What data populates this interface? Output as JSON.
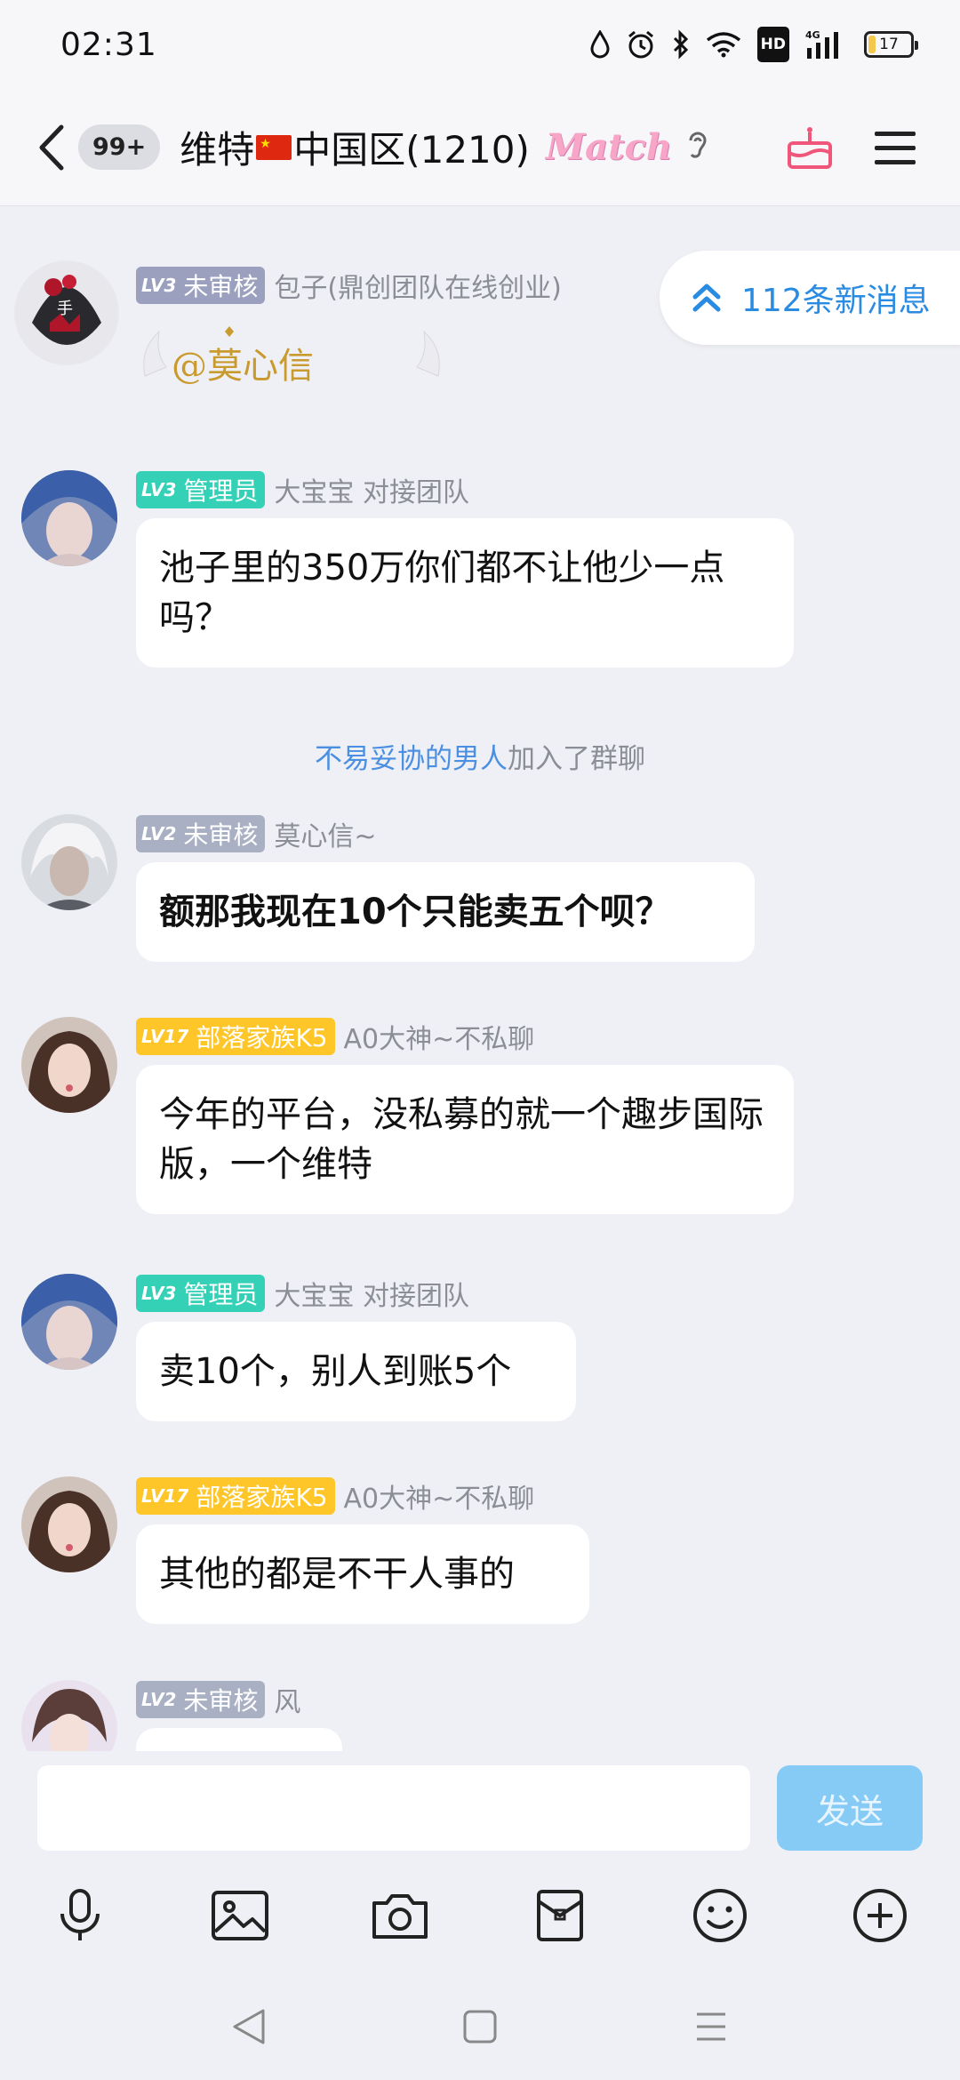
{
  "status_bar": {
    "time": "02:31",
    "network": "4G",
    "hd": "HD",
    "battery": "17",
    "battery_level": 0.17
  },
  "header": {
    "unread_count": "99+",
    "title_prefix": "维特",
    "title_suffix": "中国区(1210)",
    "logo_text": "Match"
  },
  "new_messages": {
    "label": "112条新消息"
  },
  "messages": [
    {
      "level": "LV3",
      "role": "未审核",
      "nick": "包子(鼎创团队在线创业)",
      "sticker_text": "@莫心信"
    },
    {
      "level": "LV3",
      "role": "管理员",
      "nick": "大宝宝 对接团队",
      "text": "池子里的350万你们都不让他少一点吗？"
    },
    {
      "level": "LV2",
      "role": "未审核",
      "nick": "莫心信~",
      "text": "额那我现在10个只能卖五个呗？"
    },
    {
      "level": "LV17",
      "role": "部落家族K5",
      "nick": "A0大神~不私聊",
      "text": "今年的平台，没私募的就一个趣步国际版，一个维特"
    },
    {
      "level": "LV3",
      "role": "管理员",
      "nick": "大宝宝 对接团队",
      "text": "卖10个，别人到账5个"
    },
    {
      "level": "LV17",
      "role": "部落家族K5",
      "nick": "A0大神~不私聊",
      "text": "其他的都是不干人事的"
    },
    {
      "level": "LV2",
      "role": "未审核",
      "nick": "风"
    }
  ],
  "system_notice": {
    "name": "不易妥协的男人",
    "action": "加入了群聊"
  },
  "input": {
    "placeholder": "",
    "send_label": "发送"
  },
  "colors": {
    "accent_blue": "#2a8be3",
    "send_disabled": "#86cbf6",
    "lv_gray": "#a9b0c3",
    "lv_teal": "#34d1b7",
    "lv_gold": "#ffc629"
  }
}
